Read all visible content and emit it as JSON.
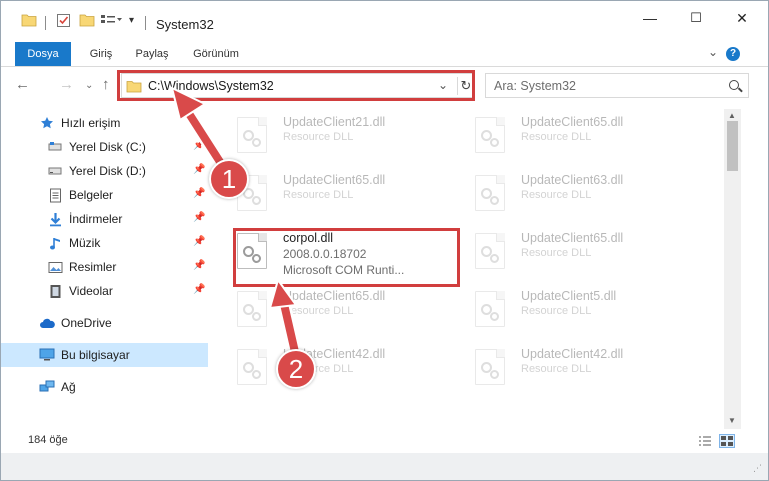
{
  "window": {
    "title": "System32",
    "controls": {
      "minimize": "—",
      "maximize": "☐",
      "close": "✕"
    }
  },
  "ribbon": {
    "tabs": [
      "Dosya",
      "Giriş",
      "Paylaş",
      "Görünüm"
    ],
    "help": "?"
  },
  "address_bar": {
    "path": "C:\\Windows\\System32",
    "dropdown_glyph": "⌄",
    "refresh_glyph": "↻"
  },
  "search": {
    "placeholder": "Ara: System32"
  },
  "nav_pane": {
    "quick_access": "Hızlı erişim",
    "items": [
      {
        "label": "Yerel Disk (C:)",
        "icon": "drive-icon",
        "pinned": true
      },
      {
        "label": "Yerel Disk (D:)",
        "icon": "drive-icon",
        "pinned": true
      },
      {
        "label": "Belgeler",
        "icon": "documents-icon",
        "pinned": true
      },
      {
        "label": "İndirmeler",
        "icon": "download-icon",
        "pinned": true
      },
      {
        "label": "Müzik",
        "icon": "music-icon",
        "pinned": true
      },
      {
        "label": "Resimler",
        "icon": "pictures-icon",
        "pinned": true
      },
      {
        "label": "Videolar",
        "icon": "videos-icon",
        "pinned": true
      }
    ],
    "onedrive": "OneDrive",
    "this_pc": "Bu bilgisayar",
    "network": "Ağ"
  },
  "files": {
    "left": [
      {
        "name": "UpdateClient21.dll",
        "desc": "Resource DLL",
        "faded": true
      },
      {
        "name": "UpdateClient65.dll",
        "desc": "Resource DLL",
        "faded": true
      },
      {
        "name": "corpol.dll",
        "type": "2008.0.0.18702",
        "desc": "Microsoft COM Runti...",
        "faded": false
      },
      {
        "name": "UpdateClient65.dll",
        "desc": "Resource DLL",
        "faded": true
      },
      {
        "name": "UpdateClient42.dll",
        "desc": "Resource DLL",
        "faded": true
      }
    ],
    "right": [
      {
        "name": "UpdateClient65.dll",
        "desc": "Resource DLL",
        "faded": true
      },
      {
        "name": "UpdateClient63.dll",
        "desc": "Resource DLL",
        "faded": true
      },
      {
        "name": "UpdateClient65.dll",
        "desc": "Resource DLL",
        "faded": true
      },
      {
        "name": "UpdateClient5.dll",
        "desc": "Resource DLL",
        "faded": true
      },
      {
        "name": "UpdateClient42.dll",
        "desc": "Resource DLL",
        "faded": true
      }
    ]
  },
  "status_bar": {
    "item_count": "184 öğe"
  },
  "annotations": {
    "callout_1": "1",
    "callout_2": "2",
    "color": "#d13e3e"
  },
  "colors": {
    "accent": "#1979ca",
    "selection": "#cce8ff"
  }
}
